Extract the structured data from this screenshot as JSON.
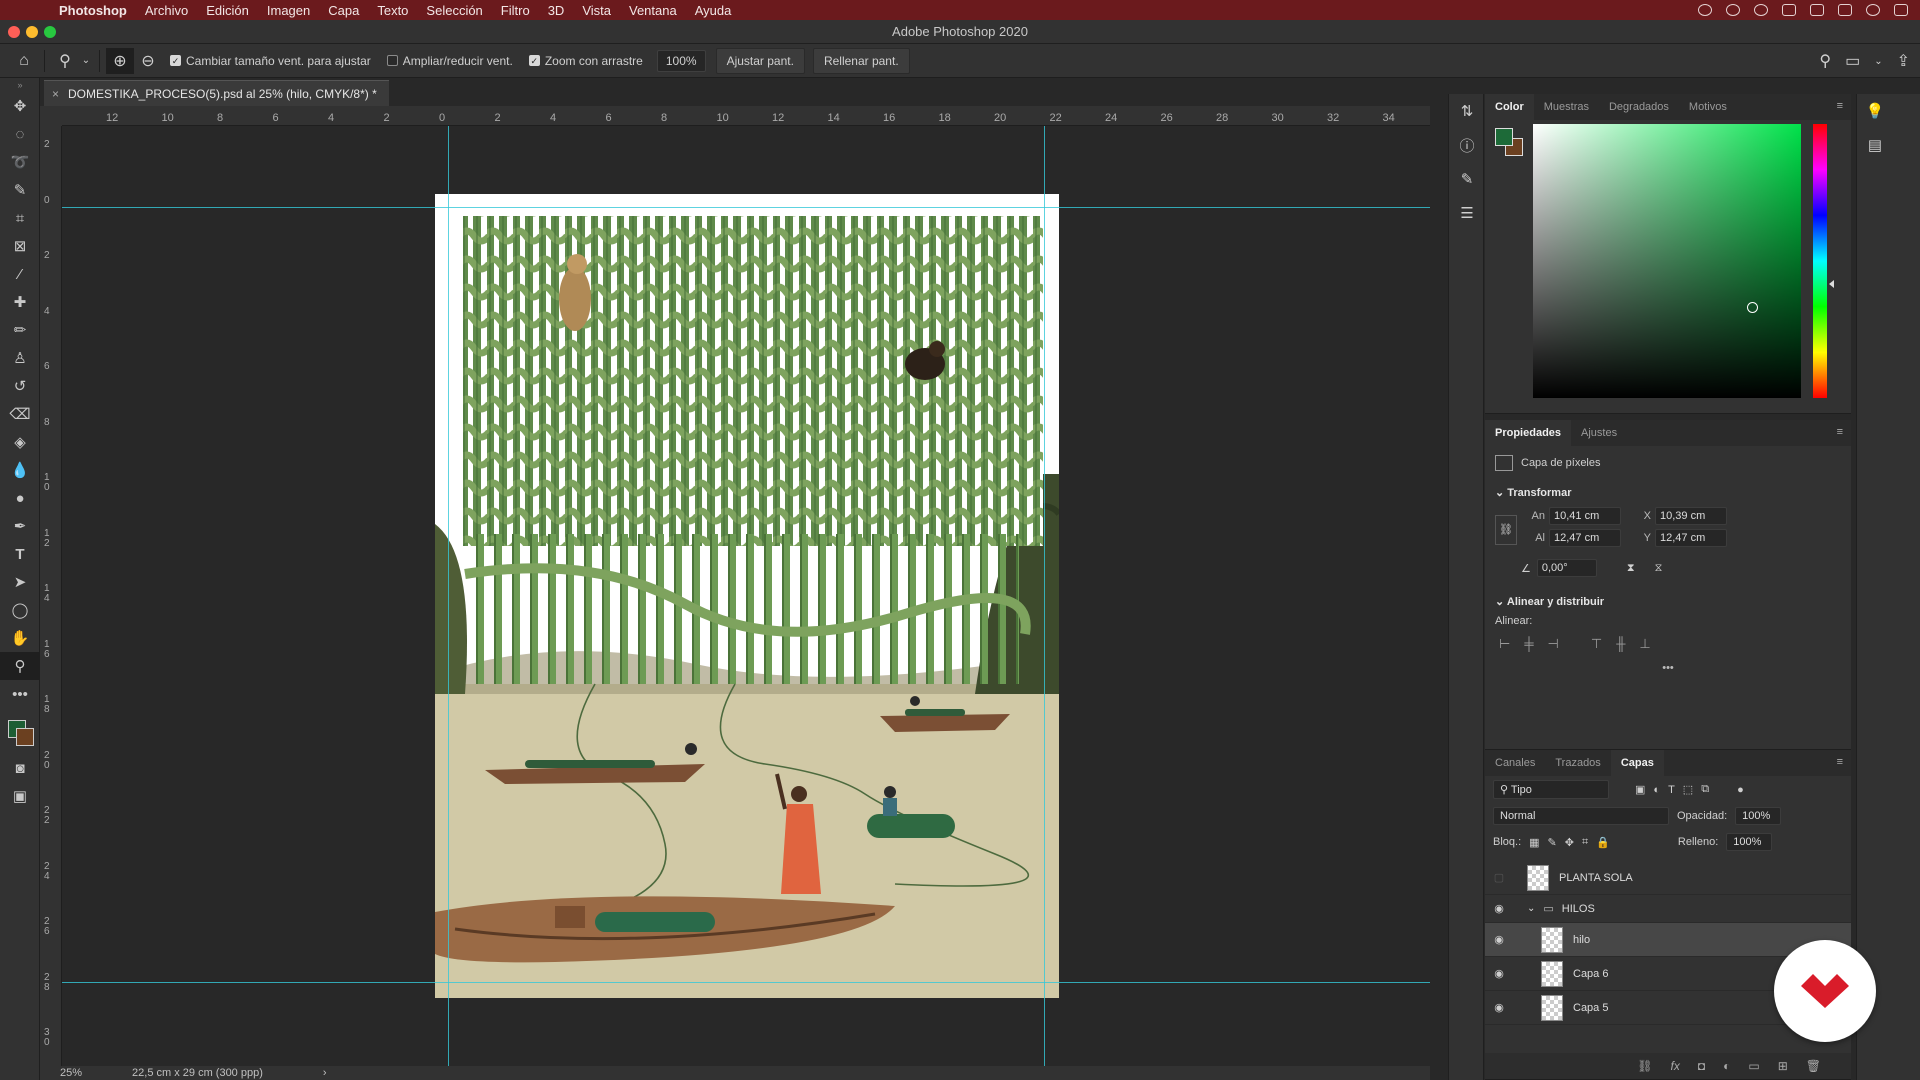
{
  "menubar": {
    "app": "Photoshop",
    "items": [
      "Archivo",
      "Edición",
      "Imagen",
      "Capa",
      "Texto",
      "Selección",
      "Filtro",
      "3D",
      "Vista",
      "Ventana",
      "Ayuda"
    ]
  },
  "titlebar": {
    "title": "Adobe Photoshop 2020"
  },
  "options": {
    "resize_windows": "Cambiar tamaño vent. para ajustar",
    "zoom_all": "Ampliar/reducir vent.",
    "scrubby_zoom": "Zoom con arrastre",
    "zoom_value": "100%",
    "fit_screen": "Ajustar pant.",
    "fill_screen": "Rellenar pant."
  },
  "document": {
    "tab_label": "DOMESTIKA_PROCESO(5).psd al 25% (hilo, CMYK/8*) *",
    "close": "×"
  },
  "ruler": {
    "h_labels": [
      "12",
      "10",
      "8",
      "6",
      "4",
      "2",
      "0",
      "2",
      "4",
      "6",
      "8",
      "10",
      "12",
      "14",
      "16",
      "18",
      "20",
      "22",
      "24",
      "26",
      "28",
      "30",
      "32",
      "34"
    ],
    "v_labels": [
      "2",
      "0",
      "2",
      "4",
      "6",
      "8",
      "1\n0",
      "1\n2",
      "1\n4",
      "1\n6",
      "1\n8",
      "2\n0",
      "2\n2",
      "2\n4",
      "2\n6",
      "2\n8",
      "3\n0"
    ]
  },
  "status": {
    "zoom": "25%",
    "doc_size": "22,5 cm x 29 cm (300 ppp)",
    "arrow": "›"
  },
  "color_panel": {
    "tabs": [
      "Color",
      "Muestras",
      "Degradados",
      "Motivos"
    ],
    "foreground": "#1d6a38",
    "background": "#6b4020"
  },
  "properties_panel": {
    "tabs": [
      "Propiedades",
      "Ajustes"
    ],
    "layer_type": "Capa de píxeles",
    "transform_title": "Transformar",
    "width_label": "An",
    "width": "10,41 cm",
    "x_label": "X",
    "x": "10,39 cm",
    "height_label": "Al",
    "height": "12,47 cm",
    "y_label": "Y",
    "y": "12,47 cm",
    "angle": "0,00°",
    "align_title": "Alinear y distribuir",
    "align_label": "Alinear:",
    "more": "•••"
  },
  "layers_panel": {
    "tabs": [
      "Canales",
      "Trazados",
      "Capas"
    ],
    "filter": "Tipo",
    "blend_mode": "Normal",
    "opacity_label": "Opacidad:",
    "opacity": "100%",
    "lock_label": "Bloq.:",
    "fill_label": "Relleno:",
    "fill": "100%",
    "layers": [
      {
        "name": "PLANTA SOLA",
        "visible": false,
        "selected": false
      },
      {
        "name": "HILOS",
        "visible": true,
        "selected": false,
        "group": true
      },
      {
        "name": "hilo",
        "visible": true,
        "selected": true
      },
      {
        "name": "Capa 6",
        "visible": true,
        "selected": false
      },
      {
        "name": "Capa 5",
        "visible": true,
        "selected": false
      }
    ]
  },
  "colors": {
    "menubar": "#6b1a1d",
    "guide": "#35c8d8",
    "badge_red": "#d91c2a"
  }
}
